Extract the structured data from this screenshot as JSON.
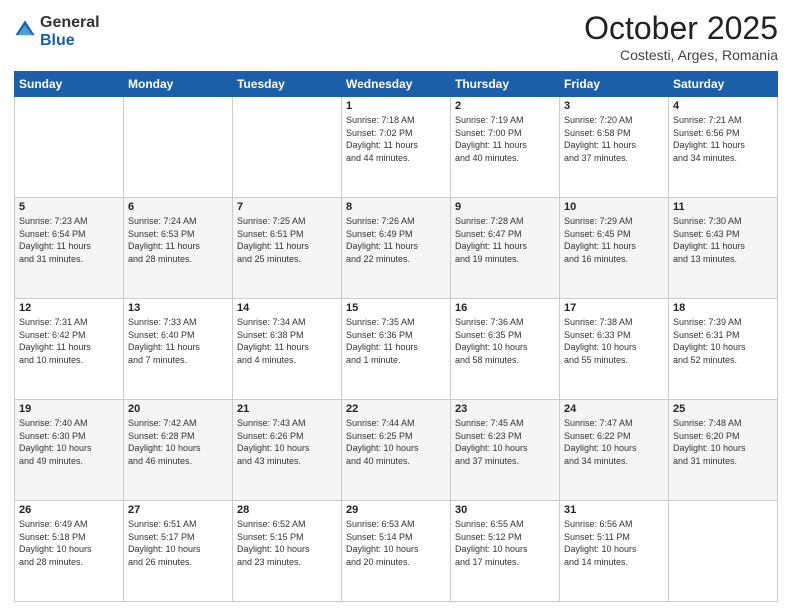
{
  "logo": {
    "general": "General",
    "blue": "Blue"
  },
  "header": {
    "month": "October 2025",
    "location": "Costesti, Arges, Romania"
  },
  "weekdays": [
    "Sunday",
    "Monday",
    "Tuesday",
    "Wednesday",
    "Thursday",
    "Friday",
    "Saturday"
  ],
  "weeks": [
    [
      {
        "day": "",
        "info": ""
      },
      {
        "day": "",
        "info": ""
      },
      {
        "day": "",
        "info": ""
      },
      {
        "day": "1",
        "info": "Sunrise: 7:18 AM\nSunset: 7:02 PM\nDaylight: 11 hours\nand 44 minutes."
      },
      {
        "day": "2",
        "info": "Sunrise: 7:19 AM\nSunset: 7:00 PM\nDaylight: 11 hours\nand 40 minutes."
      },
      {
        "day": "3",
        "info": "Sunrise: 7:20 AM\nSunset: 6:58 PM\nDaylight: 11 hours\nand 37 minutes."
      },
      {
        "day": "4",
        "info": "Sunrise: 7:21 AM\nSunset: 6:56 PM\nDaylight: 11 hours\nand 34 minutes."
      }
    ],
    [
      {
        "day": "5",
        "info": "Sunrise: 7:23 AM\nSunset: 6:54 PM\nDaylight: 11 hours\nand 31 minutes."
      },
      {
        "day": "6",
        "info": "Sunrise: 7:24 AM\nSunset: 6:53 PM\nDaylight: 11 hours\nand 28 minutes."
      },
      {
        "day": "7",
        "info": "Sunrise: 7:25 AM\nSunset: 6:51 PM\nDaylight: 11 hours\nand 25 minutes."
      },
      {
        "day": "8",
        "info": "Sunrise: 7:26 AM\nSunset: 6:49 PM\nDaylight: 11 hours\nand 22 minutes."
      },
      {
        "day": "9",
        "info": "Sunrise: 7:28 AM\nSunset: 6:47 PM\nDaylight: 11 hours\nand 19 minutes."
      },
      {
        "day": "10",
        "info": "Sunrise: 7:29 AM\nSunset: 6:45 PM\nDaylight: 11 hours\nand 16 minutes."
      },
      {
        "day": "11",
        "info": "Sunrise: 7:30 AM\nSunset: 6:43 PM\nDaylight: 11 hours\nand 13 minutes."
      }
    ],
    [
      {
        "day": "12",
        "info": "Sunrise: 7:31 AM\nSunset: 6:42 PM\nDaylight: 11 hours\nand 10 minutes."
      },
      {
        "day": "13",
        "info": "Sunrise: 7:33 AM\nSunset: 6:40 PM\nDaylight: 11 hours\nand 7 minutes."
      },
      {
        "day": "14",
        "info": "Sunrise: 7:34 AM\nSunset: 6:38 PM\nDaylight: 11 hours\nand 4 minutes."
      },
      {
        "day": "15",
        "info": "Sunrise: 7:35 AM\nSunset: 6:36 PM\nDaylight: 11 hours\nand 1 minute."
      },
      {
        "day": "16",
        "info": "Sunrise: 7:36 AM\nSunset: 6:35 PM\nDaylight: 10 hours\nand 58 minutes."
      },
      {
        "day": "17",
        "info": "Sunrise: 7:38 AM\nSunset: 6:33 PM\nDaylight: 10 hours\nand 55 minutes."
      },
      {
        "day": "18",
        "info": "Sunrise: 7:39 AM\nSunset: 6:31 PM\nDaylight: 10 hours\nand 52 minutes."
      }
    ],
    [
      {
        "day": "19",
        "info": "Sunrise: 7:40 AM\nSunset: 6:30 PM\nDaylight: 10 hours\nand 49 minutes."
      },
      {
        "day": "20",
        "info": "Sunrise: 7:42 AM\nSunset: 6:28 PM\nDaylight: 10 hours\nand 46 minutes."
      },
      {
        "day": "21",
        "info": "Sunrise: 7:43 AM\nSunset: 6:26 PM\nDaylight: 10 hours\nand 43 minutes."
      },
      {
        "day": "22",
        "info": "Sunrise: 7:44 AM\nSunset: 6:25 PM\nDaylight: 10 hours\nand 40 minutes."
      },
      {
        "day": "23",
        "info": "Sunrise: 7:45 AM\nSunset: 6:23 PM\nDaylight: 10 hours\nand 37 minutes."
      },
      {
        "day": "24",
        "info": "Sunrise: 7:47 AM\nSunset: 6:22 PM\nDaylight: 10 hours\nand 34 minutes."
      },
      {
        "day": "25",
        "info": "Sunrise: 7:48 AM\nSunset: 6:20 PM\nDaylight: 10 hours\nand 31 minutes."
      }
    ],
    [
      {
        "day": "26",
        "info": "Sunrise: 6:49 AM\nSunset: 5:18 PM\nDaylight: 10 hours\nand 28 minutes."
      },
      {
        "day": "27",
        "info": "Sunrise: 6:51 AM\nSunset: 5:17 PM\nDaylight: 10 hours\nand 26 minutes."
      },
      {
        "day": "28",
        "info": "Sunrise: 6:52 AM\nSunset: 5:15 PM\nDaylight: 10 hours\nand 23 minutes."
      },
      {
        "day": "29",
        "info": "Sunrise: 6:53 AM\nSunset: 5:14 PM\nDaylight: 10 hours\nand 20 minutes."
      },
      {
        "day": "30",
        "info": "Sunrise: 6:55 AM\nSunset: 5:12 PM\nDaylight: 10 hours\nand 17 minutes."
      },
      {
        "day": "31",
        "info": "Sunrise: 6:56 AM\nSunset: 5:11 PM\nDaylight: 10 hours\nand 14 minutes."
      },
      {
        "day": "",
        "info": ""
      }
    ]
  ]
}
